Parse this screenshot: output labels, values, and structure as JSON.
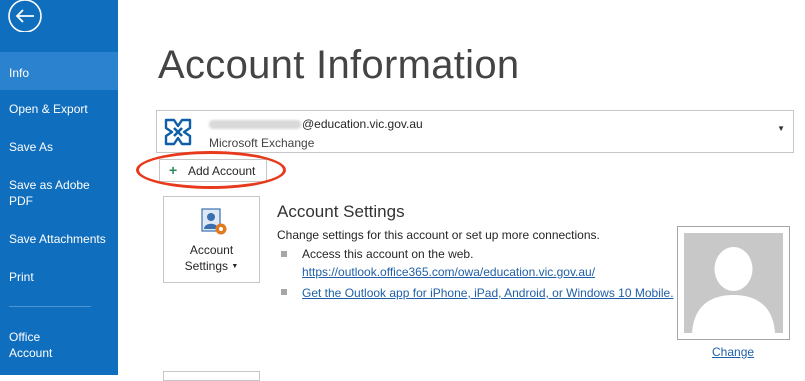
{
  "sidebar": {
    "back_icon": "back-arrow-icon",
    "items": [
      {
        "label": "Info",
        "active": true
      },
      {
        "label": "Open & Export"
      },
      {
        "label": "Save As"
      },
      {
        "label": "Save as Adobe",
        "label2": "PDF"
      },
      {
        "label": "Save Attachments"
      },
      {
        "label": "Print"
      },
      {
        "label": "Office",
        "label2": "Account"
      }
    ]
  },
  "main": {
    "title": "Account Information",
    "account": {
      "email_domain": "@education.vic.gov.au",
      "type": "Microsoft Exchange",
      "icon": "exchange-icon"
    },
    "add_account_label": "Add Account",
    "account_settings": {
      "button_label_line1": "Account",
      "button_label_line2": "Settings",
      "title": "Account Settings",
      "description": "Change settings for this account or set up more connections.",
      "bullet1_text": "Access this account on the web.",
      "bullet1_link": "https://outlook.office365.com/owa/education.vic.gov.au/",
      "bullet2_link": "Get the Outlook app for iPhone, iPad, Android, or Windows 10 Mobile."
    },
    "profile": {
      "change_label": "Change"
    }
  },
  "colors": {
    "sidebar_bg": "#106ebe",
    "active_item_bg": "#2b82cf",
    "link": "#1f5fa8",
    "highlight": "#e8391c"
  }
}
